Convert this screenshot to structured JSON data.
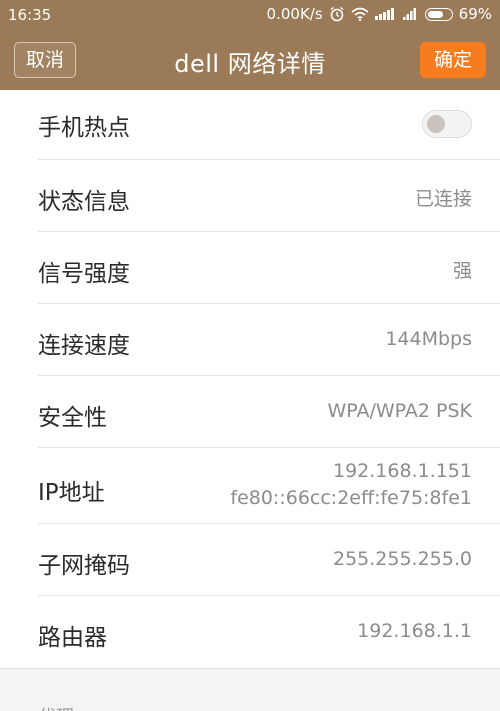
{
  "status_bar": {
    "time": "16:35",
    "net_speed": "0.00K/s",
    "battery_percent": "69%",
    "icons": [
      "alarm-icon",
      "wifi-icon",
      "signal-4g-icon",
      "signal-icon",
      "battery-icon"
    ]
  },
  "title_bar": {
    "cancel_label": "取消",
    "title": "dell  网络详情",
    "ok_label": "确定"
  },
  "rows": [
    {
      "label": "手机热点",
      "type": "toggle",
      "on": false
    },
    {
      "label": "状态信息",
      "value": "已连接"
    },
    {
      "label": "信号强度",
      "value": "强"
    },
    {
      "label": "连接速度",
      "value": "144Mbps"
    },
    {
      "label": "安全性",
      "value": "WPA/WPA2 PSK"
    },
    {
      "label": "IP地址",
      "value_line1": "192.168.1.151",
      "value_line2": "fe80::66cc:2eff:fe75:8fe1"
    },
    {
      "label": "子网掩码",
      "value": "255.255.255.0"
    },
    {
      "label": "路由器",
      "value": "192.168.1.1"
    }
  ],
  "section": {
    "header": "代理"
  },
  "colors": {
    "header_bg": "#9a7a57",
    "ok_button": "#f57c1f"
  }
}
